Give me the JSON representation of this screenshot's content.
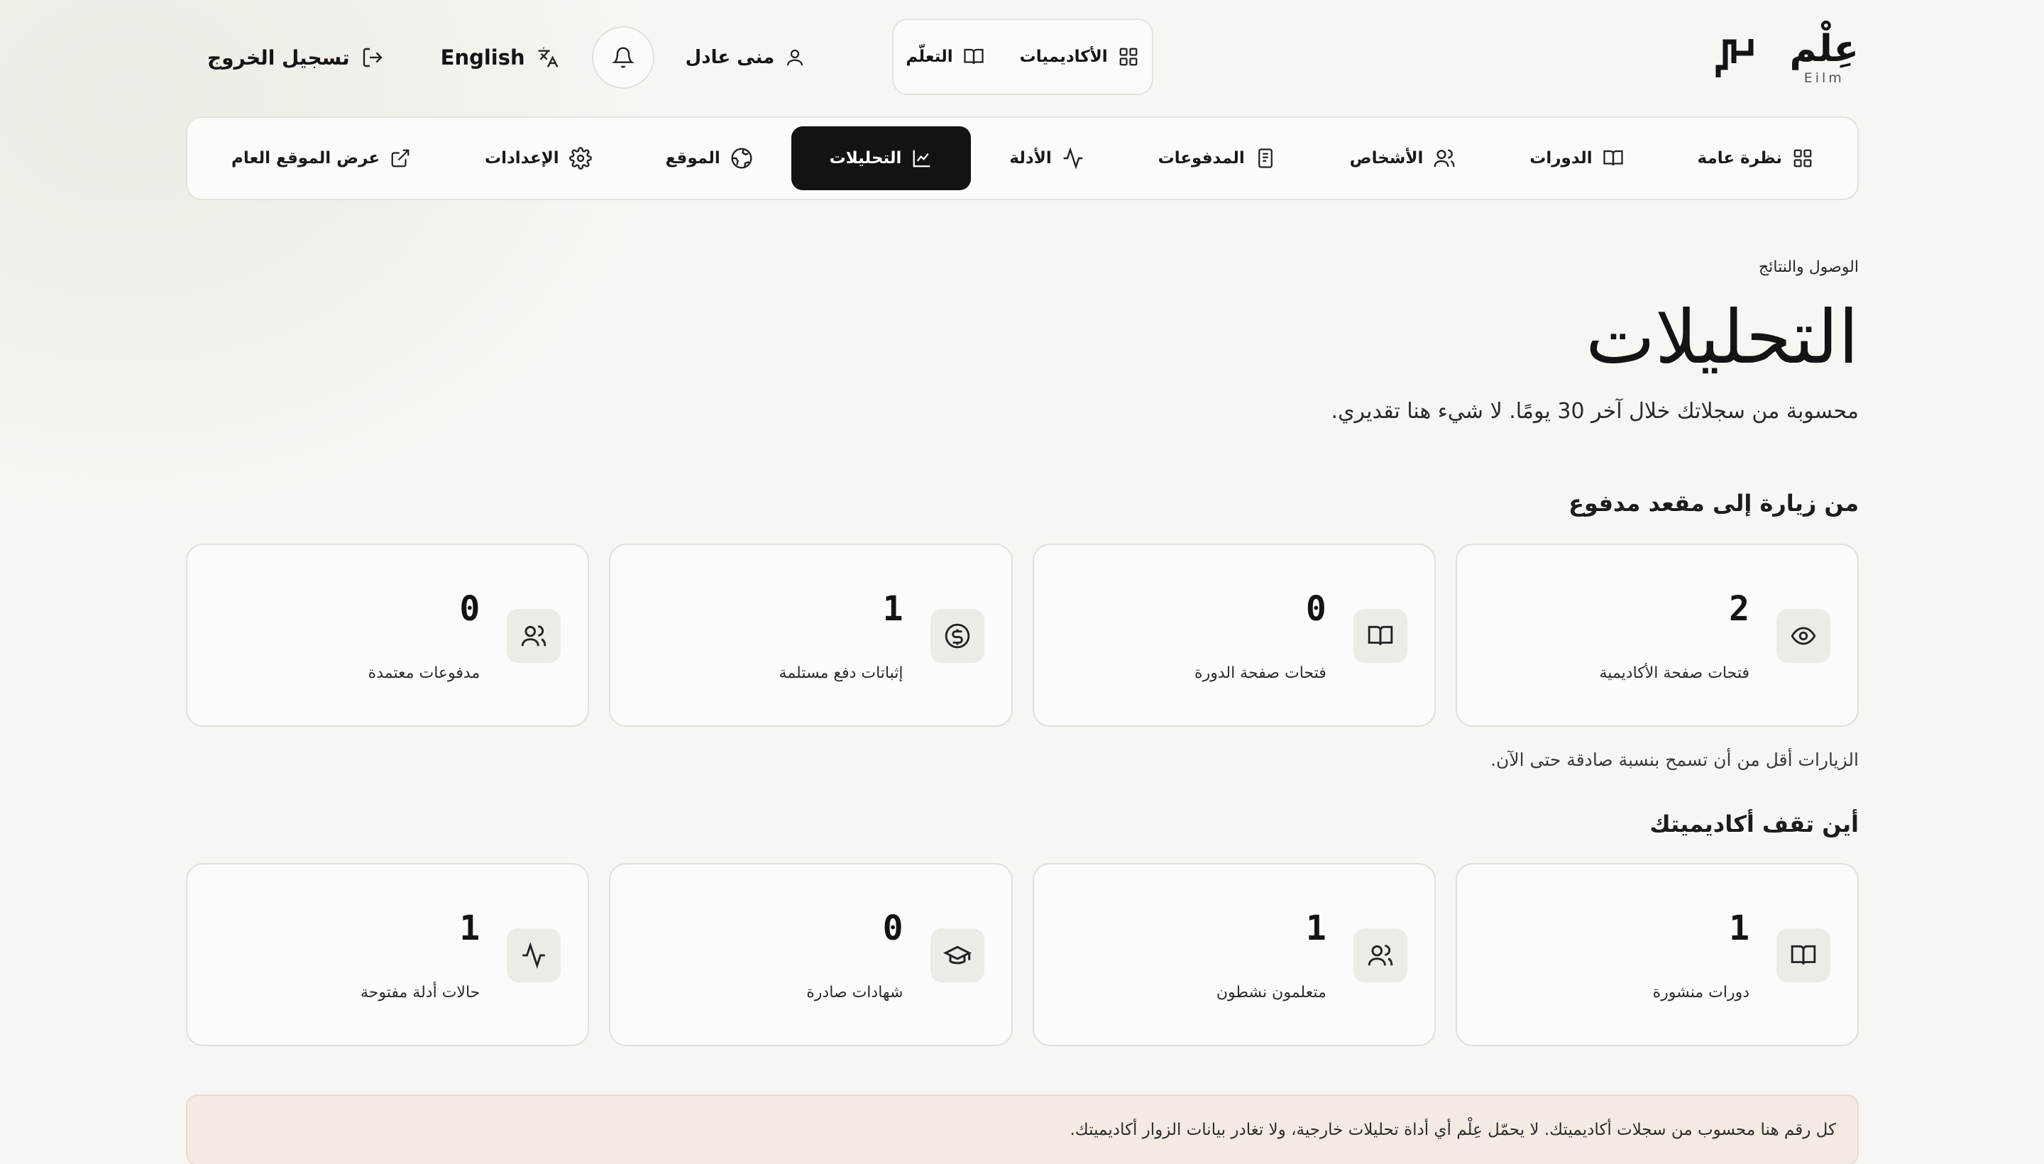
{
  "header": {
    "brand": {
      "name": "عِلْم",
      "latin": "Eilm"
    },
    "center_nav": [
      {
        "label": "الأكاديميات",
        "icon": "grid-icon"
      },
      {
        "label": "التعلّم",
        "icon": "book-open-icon"
      }
    ],
    "user_name": "منى عادل",
    "language_label": "English",
    "logout_label": "تسجيل الخروج"
  },
  "tabs": [
    {
      "label": "نظرة عامة",
      "icon": "grid-icon",
      "active": false
    },
    {
      "label": "الدورات",
      "icon": "book-open-icon",
      "active": false
    },
    {
      "label": "الأشخاص",
      "icon": "users-icon",
      "active": false
    },
    {
      "label": "المدفوعات",
      "icon": "receipt-icon",
      "active": false
    },
    {
      "label": "الأدلة",
      "icon": "activity-icon",
      "active": false
    },
    {
      "label": "التحليلات",
      "icon": "chart-icon",
      "active": true
    },
    {
      "label": "الموقع",
      "icon": "globe-icon",
      "active": false
    },
    {
      "label": "الإعدادات",
      "icon": "gear-icon",
      "active": false
    },
    {
      "label": "عرض الموقع العام",
      "icon": "external-link-icon",
      "active": false
    }
  ],
  "page": {
    "breadcrumb": "الوصول والنتائج",
    "title": "التحليلات",
    "subtitle": "محسوبة من سجلاتك خلال آخر 30 يومًا. لا شيء هنا تقديري."
  },
  "funnel": {
    "title": "من زيارة إلى مقعد مدفوع",
    "cards": [
      {
        "value": "2",
        "label": "فتحات صفحة الأكاديمية",
        "icon": "eye-icon"
      },
      {
        "value": "0",
        "label": "فتحات صفحة الدورة",
        "icon": "book-open-icon"
      },
      {
        "value": "1",
        "label": "إثباتات دفع مستلمة",
        "icon": "dollar-circle-icon"
      },
      {
        "value": "0",
        "label": "مدفوعات معتمدة",
        "icon": "users-icon"
      }
    ],
    "note": "الزيارات أقل من أن تسمح بنسبة صادقة حتى الآن."
  },
  "standing": {
    "title": "أين تقف أكاديميتك",
    "cards": [
      {
        "value": "1",
        "label": "دورات منشورة",
        "icon": "book-open-icon"
      },
      {
        "value": "1",
        "label": "متعلمون نشطون",
        "icon": "users-icon"
      },
      {
        "value": "0",
        "label": "شهادات صادرة",
        "icon": "graduation-cap-icon"
      },
      {
        "value": "1",
        "label": "حالات أدلة مفتوحة",
        "icon": "activity-icon"
      }
    ]
  },
  "footer_note": "كل رقم هنا محسوب من سجلات أكاديميتك. لا يحمّل عِلْم أي أداة تحليلات خارجية، ولا تغادر بيانات الزوار أكاديميتك."
}
